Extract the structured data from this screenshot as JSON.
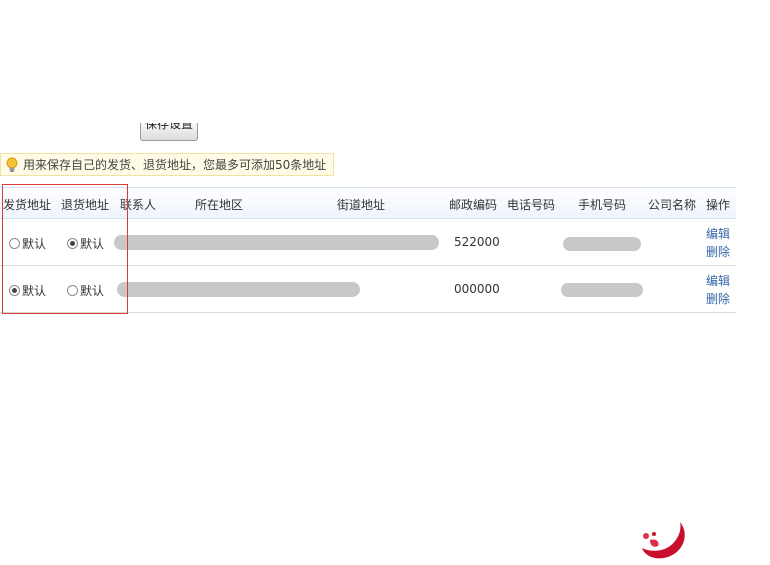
{
  "toolbar": {
    "save_label": "保存设置"
  },
  "tip": {
    "text": "用来保存自己的发货、退货地址，您最多可添加50条地址"
  },
  "table": {
    "headers": [
      "发货地址",
      "退货地址",
      "联系人",
      "所在地区",
      "街道地址",
      "邮政编码",
      "电话号码",
      "手机号码",
      "公司名称",
      "操作"
    ],
    "default_label": "默认",
    "edit_label": "编辑",
    "delete_label": "删除",
    "rows": [
      {
        "ship_default": false,
        "return_default": true,
        "postal_code": "522000"
      },
      {
        "ship_default": true,
        "return_default": false,
        "postal_code": "000000"
      }
    ]
  },
  "colors": {
    "highlight": "#d83a3a",
    "link": "#3566a8",
    "tip_bg": "#fefbe6"
  },
  "icons": {
    "tip": "lightbulb-icon",
    "brand": "brand-logo-icon"
  }
}
